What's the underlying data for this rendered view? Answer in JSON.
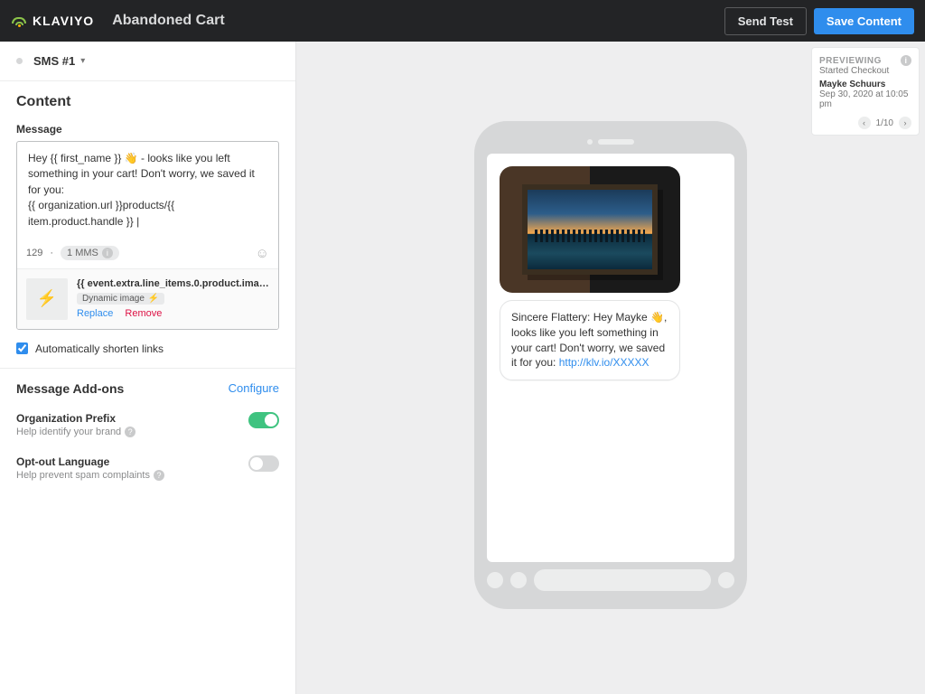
{
  "header": {
    "brand": "KLAVIYO",
    "page_title": "Abandoned Cart",
    "send_test": "Send Test",
    "save": "Save Content"
  },
  "sms_select": {
    "name": "SMS #1"
  },
  "content": {
    "title": "Content",
    "message_label": "Message",
    "message_text": "Hey {{ first_name }} 👋 - looks like you left something in your cart! Don't worry, we saved it for you:\n{{ organization.url }}products/{{ item.product.handle }} |",
    "char_count": "129",
    "mms_badge": "1 MMS",
    "attachment": {
      "path": "{{ event.extra.line_items.0.product.imag...",
      "tag": "Dynamic image",
      "replace": "Replace",
      "remove": "Remove"
    },
    "shorten_links_label": "Automatically shorten links",
    "shorten_links_checked": true
  },
  "addons": {
    "title": "Message Add-ons",
    "configure": "Configure",
    "items": [
      {
        "label": "Organization Prefix",
        "help": "Help identify your brand",
        "on": true
      },
      {
        "label": "Opt-out Language",
        "help": "Help prevent spam complaints",
        "on": false
      }
    ]
  },
  "preview": {
    "heading": "PREVIEWING",
    "event": "Started Checkout",
    "name": "Mayke Schuurs",
    "timestamp": "Sep 30, 2020 at 10:05 pm",
    "counter": "1/10"
  },
  "phone": {
    "bubble_prefix": "Sincere Flattery: Hey Mayke 👋, looks like you left something in your cart! Don't worry, we saved it for you: ",
    "bubble_link": "http://klv.io/XXXXX"
  }
}
